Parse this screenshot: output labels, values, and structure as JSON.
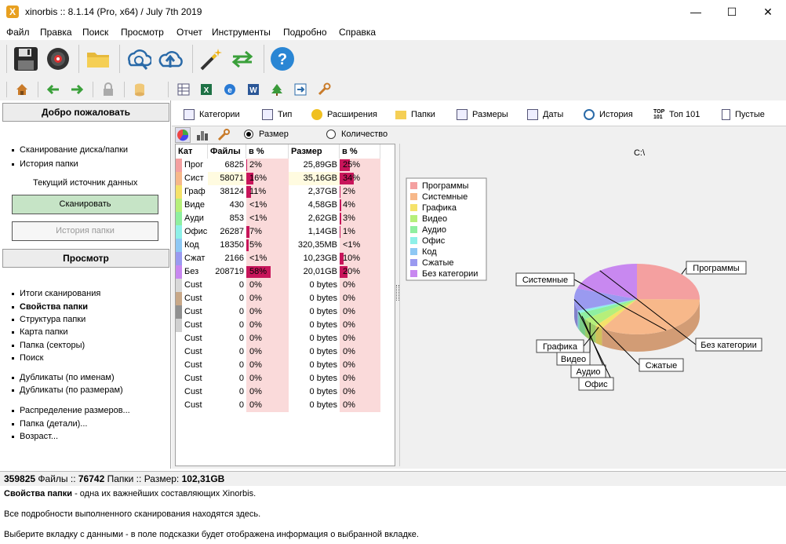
{
  "window": {
    "title": "xinorbis :: 8.1.14 (Pro, x64) / July 7th 2019",
    "app_icon": "X"
  },
  "menu": [
    "Файл",
    "Правка",
    "Поиск",
    "Просмотр",
    "Отчет",
    "Инструменты",
    "Подробно",
    "Справка"
  ],
  "left": {
    "welcome_header": "Добро пожаловать",
    "links1": [
      "Сканирование диска/папки",
      "История папки"
    ],
    "current_source": "Текущий источник данных",
    "scan_button": "Сканировать",
    "history_button": "История папки",
    "view_header": "Просмотр",
    "view_links": [
      "Итоги сканирования",
      "Свойства папки",
      "Структура папки",
      "Карта папки",
      "Папка (секторы)",
      "Поиск",
      "Дубликаты (по именам)",
      "Дубликаты (по размерам)",
      "Распределение размеров...",
      "Папка (детали)...",
      "Возраст..."
    ]
  },
  "tabs": [
    "Категории",
    "Тип",
    "Расширения",
    "Папки",
    "Размеры",
    "Даты",
    "История",
    "Топ 101",
    "Пустые"
  ],
  "options": {
    "size": "Размер",
    "count": "Количество"
  },
  "grid": {
    "headers": [
      "Кат",
      "Файлы",
      "в %",
      "Размер",
      "в %"
    ],
    "rows": [
      {
        "cat": "Прог",
        "files": "6825",
        "pf": "2%",
        "size": "25,89GB",
        "ps": "25%",
        "color": "#f4a0a0",
        "pfv": 2,
        "psv": 25
      },
      {
        "cat": "Сист",
        "files": "58071",
        "pf": "16%",
        "size": "35,16GB",
        "ps": "34%",
        "color": "#f7b88a",
        "pfv": 16,
        "psv": 34
      },
      {
        "cat": "Граф",
        "files": "38124",
        "pf": "11%",
        "size": "2,37GB",
        "ps": "2%",
        "color": "#f5e26a",
        "pfv": 11,
        "psv": 2
      },
      {
        "cat": "Виде",
        "files": "430",
        "pf": "<1%",
        "size": "4,58GB",
        "ps": "4%",
        "color": "#b6ef7a",
        "pfv": 0,
        "psv": 4
      },
      {
        "cat": "Ауди",
        "files": "853",
        "pf": "<1%",
        "size": "2,62GB",
        "ps": "3%",
        "color": "#8fefa0",
        "pfv": 0,
        "psv": 3
      },
      {
        "cat": "Офис",
        "files": "26287",
        "pf": "7%",
        "size": "1,14GB",
        "ps": "1%",
        "color": "#8ef0e8",
        "pfv": 7,
        "psv": 1
      },
      {
        "cat": "Код",
        "files": "18350",
        "pf": "5%",
        "size": "320,35MB",
        "ps": "<1%",
        "color": "#8ec8f4",
        "pfv": 5,
        "psv": 0
      },
      {
        "cat": "Сжат",
        "files": "2166",
        "pf": "<1%",
        "size": "10,23GB",
        "ps": "10%",
        "color": "#9a9af0",
        "pfv": 0,
        "psv": 10
      },
      {
        "cat": "Без",
        "files": "208719",
        "pf": "58%",
        "size": "20,01GB",
        "ps": "20%",
        "color": "#c888f0",
        "pfv": 58,
        "psv": 20
      },
      {
        "cat": "Cust",
        "files": "0",
        "pf": "0%",
        "size": "0 bytes",
        "ps": "0%",
        "color": "#d8d8d8",
        "pfv": 0,
        "psv": 0
      },
      {
        "cat": "Cust",
        "files": "0",
        "pf": "0%",
        "size": "0 bytes",
        "ps": "0%",
        "color": "#c8a888",
        "pfv": 0,
        "psv": 0
      },
      {
        "cat": "Cust",
        "files": "0",
        "pf": "0%",
        "size": "0 bytes",
        "ps": "0%",
        "color": "#909090",
        "pfv": 0,
        "psv": 0
      },
      {
        "cat": "Cust",
        "files": "0",
        "pf": "0%",
        "size": "0 bytes",
        "ps": "0%",
        "color": "#d0d0d0",
        "pfv": 0,
        "psv": 0
      },
      {
        "cat": "Cust",
        "files": "0",
        "pf": "0%",
        "size": "0 bytes",
        "ps": "0%",
        "color": "#ffffff",
        "pfv": 0,
        "psv": 0
      },
      {
        "cat": "Cust",
        "files": "0",
        "pf": "0%",
        "size": "0 bytes",
        "ps": "0%",
        "color": "#ffffff",
        "pfv": 0,
        "psv": 0
      },
      {
        "cat": "Cust",
        "files": "0",
        "pf": "0%",
        "size": "0 bytes",
        "ps": "0%",
        "color": "#ffffff",
        "pfv": 0,
        "psv": 0
      },
      {
        "cat": "Cust",
        "files": "0",
        "pf": "0%",
        "size": "0 bytes",
        "ps": "0%",
        "color": "#ffffff",
        "pfv": 0,
        "psv": 0
      },
      {
        "cat": "Cust",
        "files": "0",
        "pf": "0%",
        "size": "0 bytes",
        "ps": "0%",
        "color": "#ffffff",
        "pfv": 0,
        "psv": 0
      },
      {
        "cat": "Cust",
        "files": "0",
        "pf": "0%",
        "size": "0 bytes",
        "ps": "0%",
        "color": "#ffffff",
        "pfv": 0,
        "psv": 0
      }
    ]
  },
  "chart_data": {
    "type": "pie",
    "title": "C:\\",
    "categories": [
      "Программы",
      "Системные",
      "Графика",
      "Видео",
      "Аудио",
      "Офис",
      "Код",
      "Сжатые",
      "Без категории"
    ],
    "values": [
      25,
      34,
      2,
      4,
      3,
      1,
      0.3,
      10,
      20
    ],
    "colors": [
      "#f4a0a0",
      "#f7b88a",
      "#f5e26a",
      "#b6ef7a",
      "#8fefa0",
      "#8ef0e8",
      "#8ec8f4",
      "#9a9af0",
      "#c888f0"
    ],
    "legend_position": "top-left"
  },
  "status": {
    "files_count": "359825",
    "files_label": "Файлы",
    "folders_count": "76742",
    "folders_label": "Папки",
    "size_label": "Размер:",
    "size_value": "102,31GB"
  },
  "info": {
    "title": "Свойства папки",
    "line1": " - одна их важнейших составляющих Xinorbis.",
    "line2": "Все подробности выполненного сканирования находятся здесь.",
    "line3": "Выберите вкладку с данными - в поле подсказки будет отображена информация о выбранной вкладке."
  }
}
